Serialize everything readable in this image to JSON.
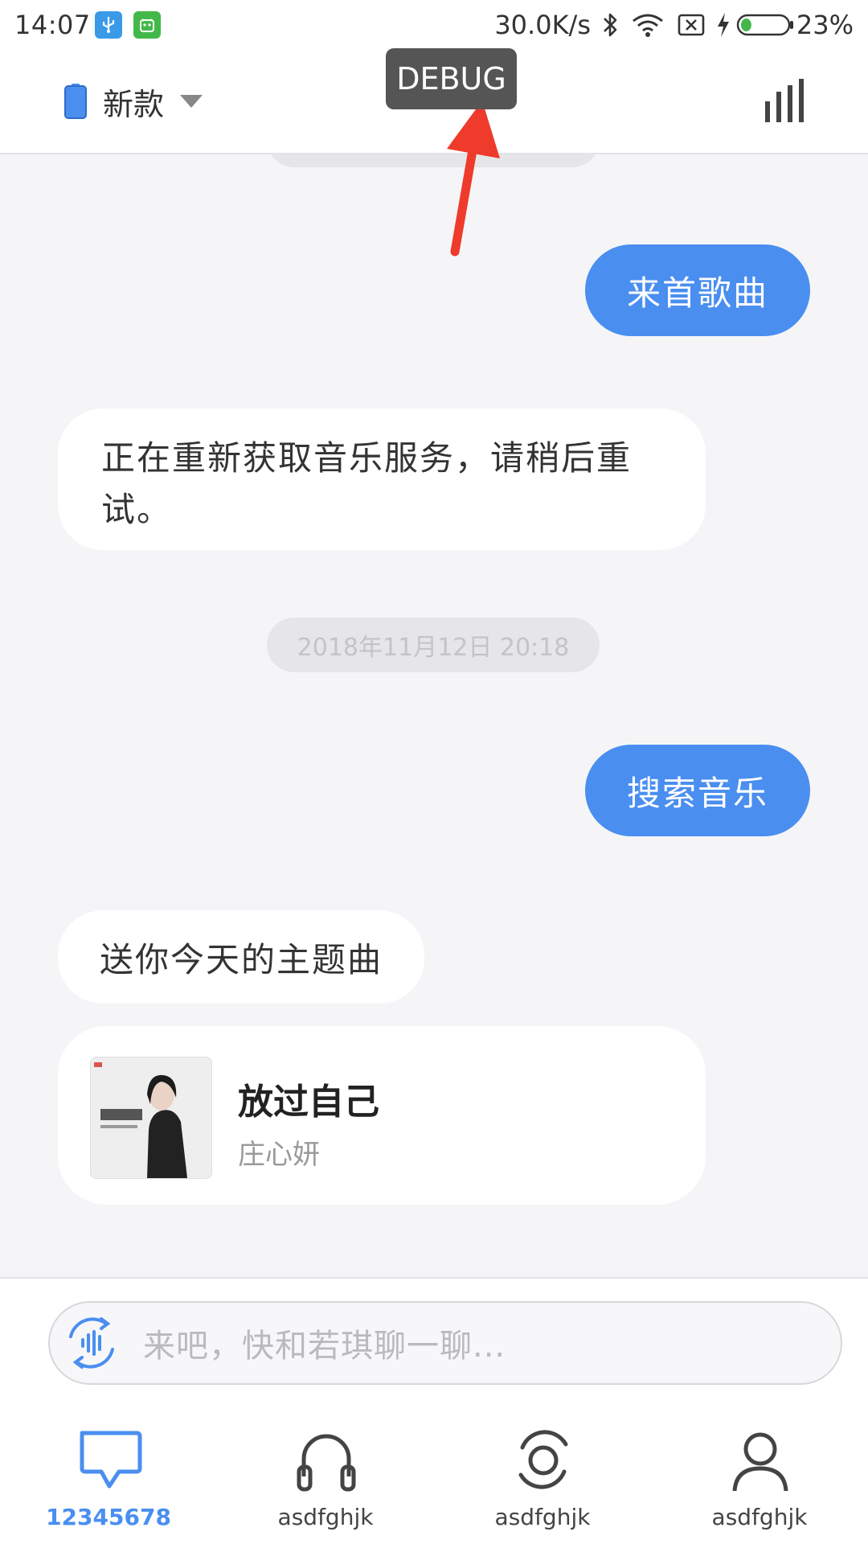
{
  "status_bar": {
    "time": "14:07",
    "network_speed": "30.0K/s",
    "battery_percent": "23%",
    "battery_level": 0.23,
    "icons": [
      "usb-icon",
      "android-icon",
      "bluetooth-icon",
      "wifi-icon",
      "sim-off-icon",
      "charging-icon",
      "battery-icon"
    ]
  },
  "header": {
    "device_label": "新款",
    "debug_badge": "DEBUG"
  },
  "chat": {
    "top_timestamp": "",
    "messages": [
      {
        "from": "user",
        "text": "来首歌曲"
      },
      {
        "from": "bot",
        "text": "正在重新获取音乐服务，请稍后重试。"
      },
      {
        "type": "timestamp",
        "text": "2018年11月12日 20:18"
      },
      {
        "from": "user",
        "text": "搜索音乐"
      },
      {
        "from": "bot",
        "text": "送你今天的主题曲"
      }
    ],
    "music_card": {
      "title": "放过自己",
      "artist": "庄心妍"
    }
  },
  "input": {
    "placeholder": "来吧，快和若琪聊一聊..."
  },
  "bottom_nav": [
    {
      "label": "12345678",
      "icon": "chat-icon",
      "active": true
    },
    {
      "label": "asdfghjk",
      "icon": "headphones-icon",
      "active": false
    },
    {
      "label": "asdfghjk",
      "icon": "speaker-icon",
      "active": false
    },
    {
      "label": "asdfghjk",
      "icon": "user-icon",
      "active": false
    }
  ],
  "colors": {
    "accent": "#4a8ef0",
    "background": "#f5f5f7",
    "debug": "#555555",
    "arrow": "#ee3b2c"
  }
}
